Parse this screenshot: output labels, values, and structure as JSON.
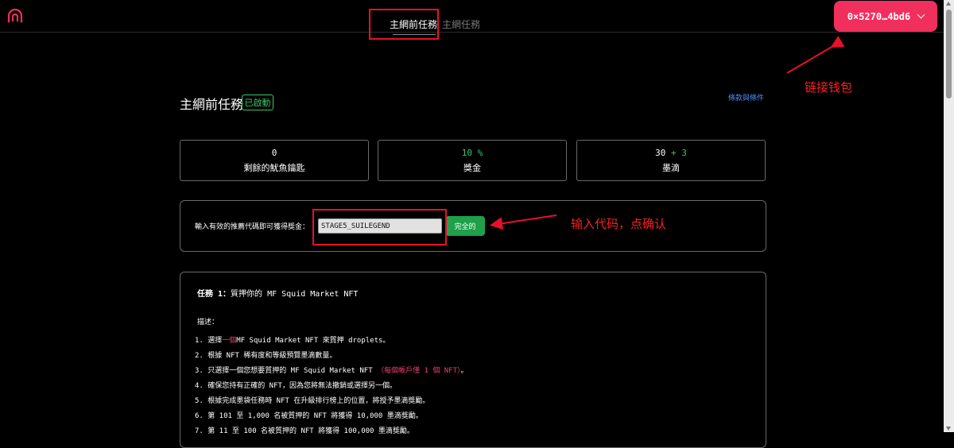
{
  "header": {
    "tabs": [
      {
        "label": "主網前任務",
        "active": true
      },
      {
        "label": "主網任務",
        "active": false
      }
    ],
    "wallet_label": "0×5270…4bd6",
    "accent_color": "#f02f5c"
  },
  "annotations": {
    "wallet_note": "链接钱包",
    "code_note": "输入代码，点确认"
  },
  "page": {
    "title": "主網前任務",
    "status_badge": "已啟動",
    "terms_link": "條款與條件"
  },
  "stats": [
    {
      "value": "0",
      "label": "剩餘的魷魚鑰匙"
    },
    {
      "value": "10 %",
      "label": "獎金"
    },
    {
      "value": "30",
      "bonus": "+ 3",
      "label": "墨滴"
    }
  ],
  "referral": {
    "label": "輸入有效的推薦代碼即可獲得獎金：",
    "code_value": "STAGE5_SUILEGEND",
    "confirm_label": "完全的"
  },
  "task": {
    "title_prefix": "任務 1：",
    "title_text": "質押你的 MF Squid Market NFT",
    "description_label": "描述：",
    "steps": [
      {
        "num": "1.",
        "pre": "選擇",
        "red": "一個",
        "post": "MF Squid Market NFT 來質押 droplets。"
      },
      {
        "num": "2.",
        "text": "根據 NFT 稀有度和等級預覽墨滴數量。"
      },
      {
        "num": "3.",
        "text": "只選擇一個您想要質押的 MF Squid Market NFT",
        "red": "（每個帳戶僅 1 個 NFT）",
        "post": "。"
      },
      {
        "num": "4.",
        "text": "確保您持有正確的 NFT，因為您將無法撤銷或選擇另一個。"
      },
      {
        "num": "5.",
        "text": "根據完成墨袋任務時 NFT 在升級排行榜上的位置，將授予墨滴獎勵。"
      },
      {
        "num": "6.",
        "text": "第 101 至 1,000 名被質押的 NFT 將獲得 10,000 墨滴獎勵。"
      },
      {
        "num": "7.",
        "text": "第 11 至 100 名被質押的 NFT 將獲得 100,000 墨滴獎勵。"
      }
    ]
  }
}
